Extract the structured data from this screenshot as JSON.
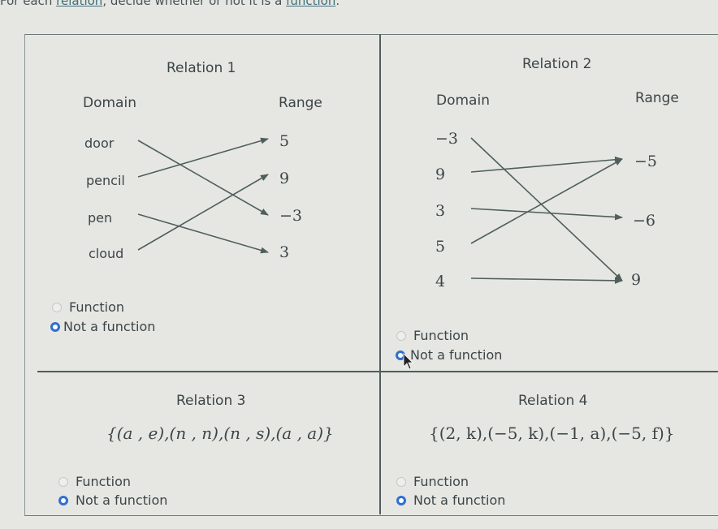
{
  "prompt": {
    "pre": "For each ",
    "link1": "relation",
    "mid": ", decide whether or not it is a ",
    "link2": "function",
    "post": "."
  },
  "relations": [
    {
      "title": "Relation 1",
      "domain_label": "Domain",
      "range_label": "Range",
      "domain": [
        "door",
        "pencil",
        "pen",
        "cloud"
      ],
      "range": [
        "5",
        "9",
        "−3",
        "3"
      ],
      "mapping": [
        [
          "door",
          "−3"
        ],
        [
          "pencil",
          "5"
        ],
        [
          "pen",
          "3"
        ],
        [
          "cloud",
          "9"
        ]
      ],
      "options": [
        "Function",
        "Not a function"
      ],
      "selected": "Not a function"
    },
    {
      "title": "Relation 2",
      "domain_label": "Domain",
      "range_label": "Range",
      "domain": [
        "−3",
        "9",
        "3",
        "5",
        "4"
      ],
      "range": [
        "−5",
        "−6",
        "9"
      ],
      "mapping": [
        [
          "−3",
          "9"
        ],
        [
          "9",
          "−5"
        ],
        [
          "3",
          "−6"
        ],
        [
          "5",
          "−5"
        ],
        [
          "4",
          "9"
        ]
      ],
      "options": [
        "Function",
        "Not a function"
      ],
      "selected": "Not a function"
    },
    {
      "title": "Relation 3",
      "set": "{(a , e),(n , n),(n , s),(a , a)}",
      "options": [
        "Function",
        "Not a function"
      ],
      "selected": "Not a function"
    },
    {
      "title": "Relation 4",
      "set": "{(2, k),(−5, k),(−1, a),(−5, f)}",
      "options": [
        "Function",
        "Not a function"
      ],
      "selected": "Not a function"
    }
  ],
  "colors": {
    "radio_selected": "#2f6fd0",
    "line": "#4f5f5c",
    "link": "#3f6f7a"
  }
}
